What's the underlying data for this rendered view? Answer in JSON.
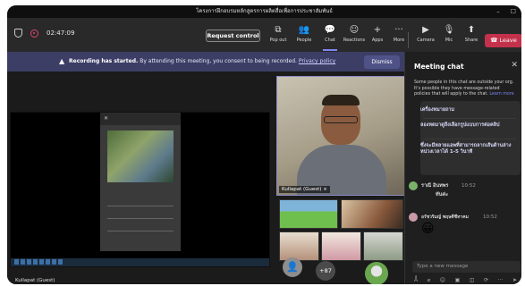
{
  "window": {
    "title": "โครงการฝึกอบรมหลักสูตรการผลิตสื่อเพื่อการประชาสัมพันธ์",
    "controls": [
      "–",
      "☐"
    ]
  },
  "toolbar": {
    "timer": "02:47:09",
    "request_control": "Request control",
    "buttons": [
      {
        "label": "Pop out",
        "icon": "pop-out-icon",
        "glyph": "⧉"
      },
      {
        "label": "People",
        "icon": "people-icon",
        "glyph": "👥"
      },
      {
        "label": "Chat",
        "icon": "chat-icon",
        "glyph": "💬"
      },
      {
        "label": "Reactions",
        "icon": "reactions-icon",
        "glyph": "☺"
      },
      {
        "label": "Apps",
        "icon": "apps-icon",
        "glyph": "+"
      },
      {
        "label": "More",
        "icon": "more-icon",
        "glyph": "···"
      },
      {
        "label": "Camera",
        "icon": "camera-icon",
        "glyph": "▶"
      },
      {
        "label": "Mic",
        "icon": "mic-icon",
        "glyph": "🎙"
      },
      {
        "label": "Share",
        "icon": "share-icon",
        "glyph": "⬆"
      }
    ],
    "leave": "Leave",
    "accent": "#7f85f5",
    "leave_color": "#c4314b"
  },
  "banner": {
    "prefix": "Recording has started.",
    "message": "By attending this meeting, you consent to being recorded.",
    "link": "Privacy policy",
    "dismiss": "Dismiss"
  },
  "stage": {
    "presenter_name": "Kullapat (Guest)",
    "main_video_label": "Kullapat (Guest)",
    "more_participants": "+87"
  },
  "chat": {
    "title": "Meeting chat",
    "notice": "Some people in this chat are outside your org. It's possible they have message-related policies that will apply to the chat.",
    "notice_link": "Learn more",
    "message_lines": [
      "เครื่องหมายถาม",
      "ลองหดมาดูถึงเลือกรูปแบบการต่อคลิป",
      "ซึ่งจะมีหลายแอพที่สามารถลากเส้นด้านล่างหน่วงเวลาได้ 1-5 วินาที"
    ],
    "messages": [
      {
        "sender": "ราณี อินทพร",
        "time": "10:52",
        "text": "ทันค่ะ"
      },
      {
        "sender": "อรัชวริมญ์ พฤษตีชีทาคม",
        "time": "10:52",
        "text": "😀"
      }
    ],
    "compose_placeholder": "Type a new message"
  }
}
